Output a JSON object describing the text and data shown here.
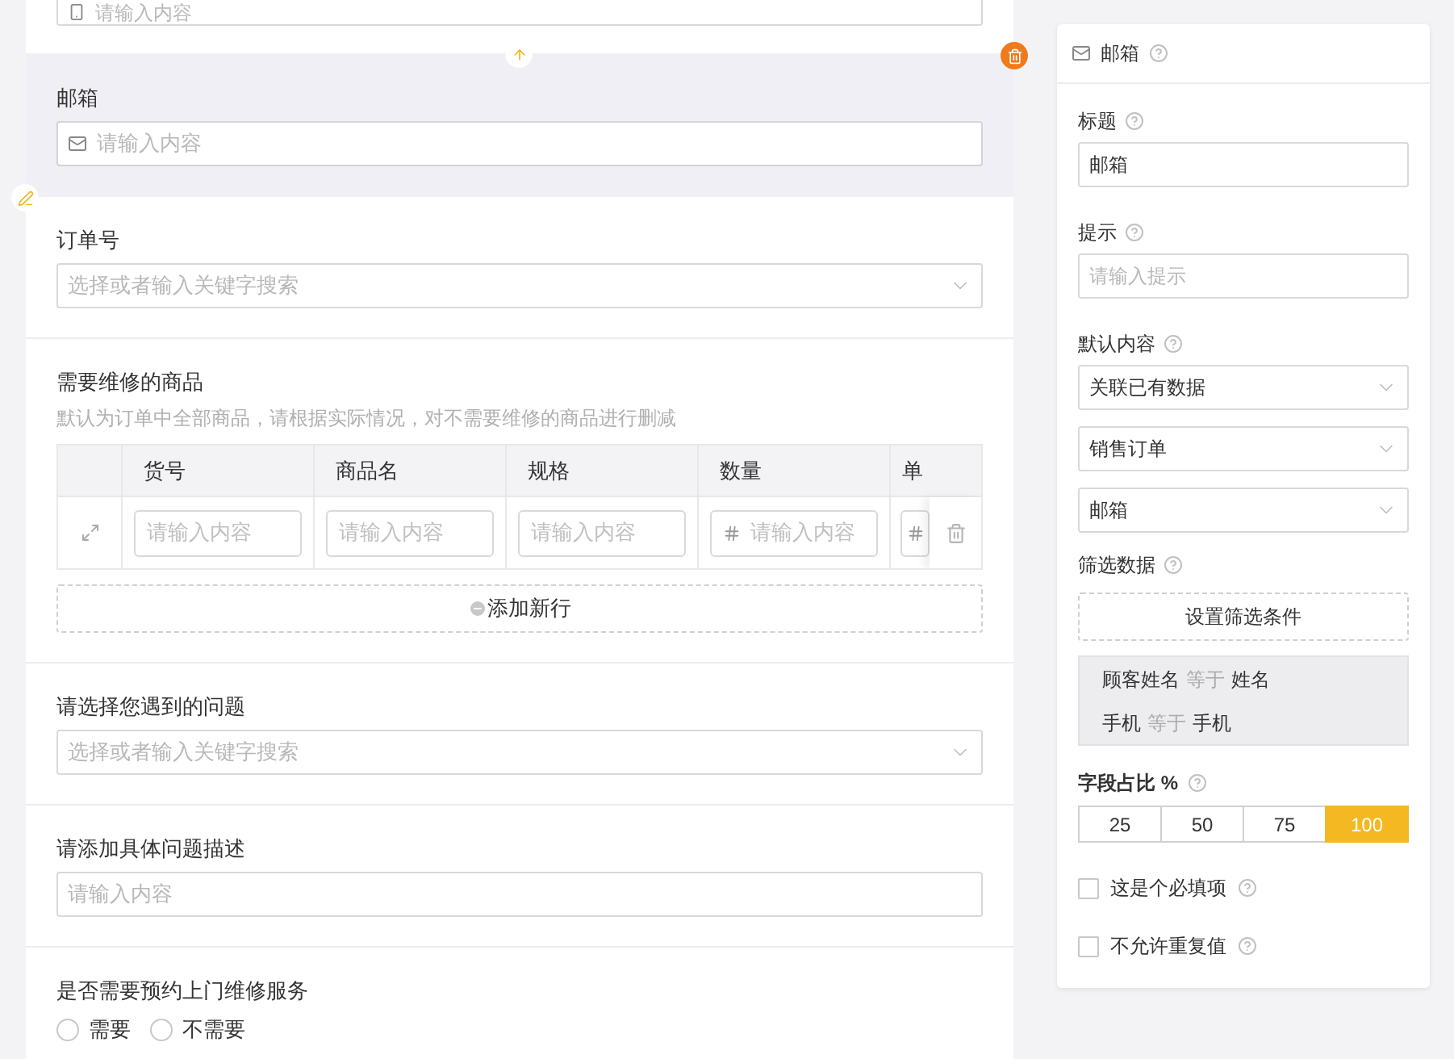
{
  "form": {
    "top_field": {
      "placeholder": "请输入内容"
    },
    "selected_field": {
      "label": "邮箱",
      "placeholder": "请输入内容"
    },
    "fields": [
      {
        "kind": "select",
        "label": "订单号",
        "placeholder": "选择或者输入关键字搜索"
      },
      {
        "kind": "table",
        "label": "需要维修的商品",
        "hint": "默认为订单中全部商品，请根据实际情况，对不需要维修的商品进行删减",
        "columns": [
          "货号",
          "商品名",
          "规格",
          "数量",
          "单"
        ],
        "cells": [
          {
            "kind": "text",
            "placeholder": "请输入内容"
          },
          {
            "kind": "text",
            "placeholder": "请输入内容"
          },
          {
            "kind": "text",
            "placeholder": "请输入内容"
          },
          {
            "kind": "number",
            "placeholder": "请输入内容"
          },
          {
            "kind": "number"
          }
        ],
        "add_row": "添加新行"
      },
      {
        "kind": "select",
        "label": "请选择您遇到的问题",
        "placeholder": "选择或者输入关键字搜索"
      },
      {
        "kind": "input",
        "label": "请添加具体问题描述",
        "placeholder": "请输入内容"
      },
      {
        "kind": "radio",
        "label": "是否需要预约上门维修服务",
        "options": [
          {
            "label": "需要",
            "selected": false
          },
          {
            "label": "不需要",
            "selected": false
          }
        ]
      }
    ]
  },
  "panel": {
    "title": "邮箱",
    "title_field": {
      "label": "标题",
      "value": "邮箱"
    },
    "hint_field": {
      "label": "提示",
      "placeholder": "请输入提示"
    },
    "default_content": {
      "label": "默认内容",
      "selects": [
        "关联已有数据",
        "销售订单",
        "邮箱"
      ]
    },
    "filter": {
      "label": "筛选数据",
      "button": "设置筛选条件",
      "conditions": [
        {
          "field": "顾客姓名",
          "op": "等于",
          "value": "姓名"
        },
        {
          "field": "手机",
          "op": "等于",
          "value": "手机"
        }
      ]
    },
    "width": {
      "label": "字段占比 %",
      "options": [
        {
          "label": "25",
          "selected": false
        },
        {
          "label": "50",
          "selected": false
        },
        {
          "label": "75",
          "selected": false
        },
        {
          "label": "100",
          "selected": true
        }
      ]
    },
    "checks": [
      {
        "label": "这是个必填项",
        "checked": false
      },
      {
        "label": "不允许重复值",
        "checked": false
      }
    ]
  }
}
